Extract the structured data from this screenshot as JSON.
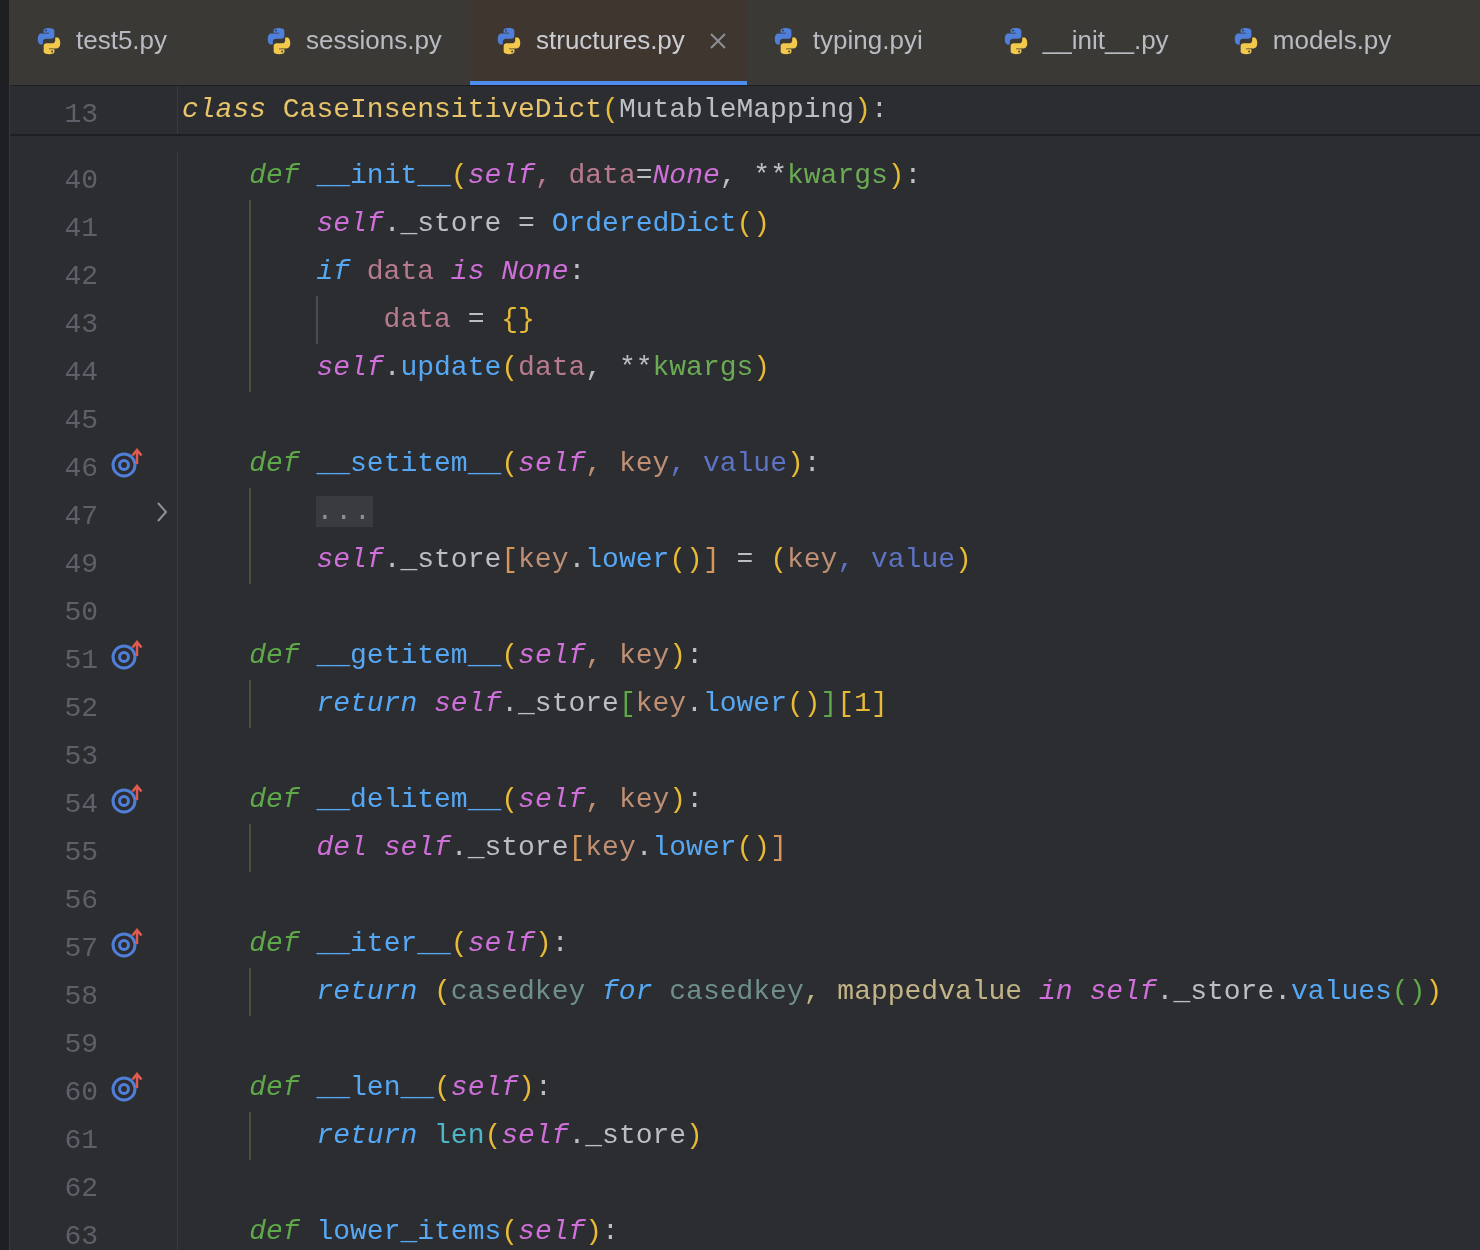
{
  "tabs": [
    {
      "label": "test5.py",
      "selected": false
    },
    {
      "label": "sessions.py",
      "selected": false
    },
    {
      "label": "structures.py",
      "selected": true
    },
    {
      "label": "typing.pyi",
      "selected": false
    },
    {
      "label": "__init__.py",
      "selected": false
    },
    {
      "label": "models.py",
      "selected": false
    }
  ],
  "sticky_line": {
    "number": "13",
    "tokens": [
      {
        "text": "class",
        "kind": "decl"
      },
      {
        "text": " CaseInsensitiveDict",
        "kind": "cls"
      },
      {
        "text": "(",
        "kind": "paren1"
      },
      {
        "text": "MutableMapping",
        "kind": "plain"
      },
      {
        "text": ")",
        "kind": "paren1"
      },
      {
        "text": ":",
        "kind": "plain"
      }
    ]
  },
  "lines": [
    {
      "number": "40",
      "tokens": [
        {
          "text": "def",
          "kind": "def"
        },
        {
          "text": " __init__",
          "kind": "fn"
        },
        {
          "text": "(",
          "kind": "paren1"
        },
        {
          "text": "self",
          "kind": "self"
        },
        {
          "text": ", data",
          "kind": "param"
        },
        {
          "text": "=",
          "kind": "plain"
        },
        {
          "text": "None",
          "kind": "const"
        },
        {
          "text": ", **",
          "kind": "plain"
        },
        {
          "text": "kwargs",
          "kind": "kwargs"
        },
        {
          "text": ")",
          "kind": "paren1"
        },
        {
          "text": ":",
          "kind": "plain"
        }
      ],
      "children": [
        {
          "number": "41",
          "tokens": [
            {
              "text": "self",
              "kind": "self"
            },
            {
              "text": "._store = ",
              "kind": "plain"
            },
            {
              "text": "OrderedDict",
              "kind": "fn"
            },
            {
              "text": "()",
              "kind": "paren1"
            }
          ]
        },
        {
          "number": "42",
          "tokens": [
            {
              "text": "if",
              "kind": "ctl"
            },
            {
              "text": " data",
              "kind": "param"
            },
            {
              "text": " is",
              "kind": "const"
            },
            {
              "text": " None",
              "kind": "const"
            },
            {
              "text": ":",
              "kind": "plain"
            }
          ],
          "children": [
            {
              "number": "43",
              "tokens": [
                {
                  "text": "data",
                  "kind": "param"
                },
                {
                  "text": " = ",
                  "kind": "plain"
                },
                {
                  "text": "{}",
                  "kind": "paren1"
                }
              ]
            }
          ]
        },
        {
          "number": "44",
          "tokens": [
            {
              "text": "self",
              "kind": "self"
            },
            {
              "text": ".",
              "kind": "plain"
            },
            {
              "text": "update",
              "kind": "fn"
            },
            {
              "text": "(",
              "kind": "paren1"
            },
            {
              "text": "data",
              "kind": "param"
            },
            {
              "text": ", **",
              "kind": "plain"
            },
            {
              "text": "kwargs",
              "kind": "kwargs"
            },
            {
              "text": ")",
              "kind": "paren1"
            }
          ]
        }
      ]
    },
    {
      "number": "45"
    },
    {
      "number": "46",
      "overridden": true,
      "tokens": [
        {
          "text": "def",
          "kind": "def"
        },
        {
          "text": " __setitem__",
          "kind": "fn"
        },
        {
          "text": "(",
          "kind": "paren1"
        },
        {
          "text": "self",
          "kind": "self"
        },
        {
          "text": ", key",
          "kind": "arg"
        },
        {
          "text": ", value",
          "kind": "arg2"
        },
        {
          "text": ")",
          "kind": "paren1"
        },
        {
          "text": ":",
          "kind": "plain"
        }
      ],
      "children": [
        {
          "number": "47",
          "folded": true,
          "tokens": [
            {
              "text": "...",
              "kind": "placeholder"
            }
          ]
        },
        {
          "number": "49",
          "tokens": [
            {
              "text": "self",
              "kind": "self"
            },
            {
              "text": "._store",
              "kind": "plain"
            },
            {
              "text": "[",
              "kind": "paren2"
            },
            {
              "text": "key",
              "kind": "arg"
            },
            {
              "text": ".",
              "kind": "plain"
            },
            {
              "text": "lower",
              "kind": "fn"
            },
            {
              "text": "()",
              "kind": "paren1"
            },
            {
              "text": "]",
              "kind": "paren2"
            },
            {
              "text": " = ",
              "kind": "plain"
            },
            {
              "text": "(",
              "kind": "paren1"
            },
            {
              "text": "key",
              "kind": "arg"
            },
            {
              "text": ", value",
              "kind": "arg2"
            },
            {
              "text": ")",
              "kind": "paren1"
            }
          ]
        }
      ]
    },
    {
      "number": "50"
    },
    {
      "number": "51",
      "overridden": true,
      "tokens": [
        {
          "text": "def",
          "kind": "def"
        },
        {
          "text": " __getitem__",
          "kind": "fn"
        },
        {
          "text": "(",
          "kind": "paren1"
        },
        {
          "text": "self",
          "kind": "self"
        },
        {
          "text": ", key",
          "kind": "arg"
        },
        {
          "text": ")",
          "kind": "paren1"
        },
        {
          "text": ":",
          "kind": "plain"
        }
      ],
      "children": [
        {
          "number": "52",
          "tokens": [
            {
              "text": "return",
              "kind": "ctl"
            },
            {
              "text": " self",
              "kind": "self"
            },
            {
              "text": "._store",
              "kind": "plain"
            },
            {
              "text": "[",
              "kind": "paren3"
            },
            {
              "text": "key",
              "kind": "arg"
            },
            {
              "text": ".",
              "kind": "plain"
            },
            {
              "text": "lower",
              "kind": "fn"
            },
            {
              "text": "()",
              "kind": "paren1"
            },
            {
              "text": "]",
              "kind": "paren3"
            },
            {
              "text": "[1]",
              "kind": "paren1"
            }
          ]
        }
      ]
    },
    {
      "number": "53"
    },
    {
      "number": "54",
      "overridden": true,
      "tokens": [
        {
          "text": "def",
          "kind": "def"
        },
        {
          "text": " __delitem__",
          "kind": "fn"
        },
        {
          "text": "(",
          "kind": "paren1"
        },
        {
          "text": "self",
          "kind": "self"
        },
        {
          "text": ", key",
          "kind": "arg"
        },
        {
          "text": ")",
          "kind": "paren1"
        },
        {
          "text": ":",
          "kind": "plain"
        }
      ],
      "children": [
        {
          "number": "55",
          "tokens": [
            {
              "text": "del",
              "kind": "const"
            },
            {
              "text": " self",
              "kind": "self"
            },
            {
              "text": "._store",
              "kind": "plain"
            },
            {
              "text": "[",
              "kind": "paren2"
            },
            {
              "text": "key",
              "kind": "arg"
            },
            {
              "text": ".",
              "kind": "plain"
            },
            {
              "text": "lower",
              "kind": "fn"
            },
            {
              "text": "()",
              "kind": "paren1"
            },
            {
              "text": "]",
              "kind": "paren2"
            }
          ]
        }
      ]
    },
    {
      "number": "56"
    },
    {
      "number": "57",
      "overridden": true,
      "tokens": [
        {
          "text": "def",
          "kind": "def"
        },
        {
          "text": " __iter__",
          "kind": "fn"
        },
        {
          "text": "(",
          "kind": "paren1"
        },
        {
          "text": "self",
          "kind": "self"
        },
        {
          "text": ")",
          "kind": "paren1"
        },
        {
          "text": ":",
          "kind": "plain"
        }
      ],
      "children": [
        {
          "number": "58",
          "tokens": [
            {
              "text": "return",
              "kind": "ctl"
            },
            {
              "text": " (",
              "kind": "paren1"
            },
            {
              "text": "casedkey",
              "kind": "local"
            },
            {
              "text": " for",
              "kind": "ctl"
            },
            {
              "text": " casedkey",
              "kind": "local"
            },
            {
              "text": ", mappedvalue",
              "kind": "local2"
            },
            {
              "text": " in",
              "kind": "const"
            },
            {
              "text": " self",
              "kind": "self"
            },
            {
              "text": "._store.",
              "kind": "plain"
            },
            {
              "text": "values",
              "kind": "fn"
            },
            {
              "text": "()",
              "kind": "paren3"
            },
            {
              "text": ")",
              "kind": "paren1"
            }
          ]
        }
      ]
    },
    {
      "number": "59"
    },
    {
      "number": "60",
      "overridden": true,
      "tokens": [
        {
          "text": "def",
          "kind": "def"
        },
        {
          "text": " __len__",
          "kind": "fn"
        },
        {
          "text": "(",
          "kind": "paren1"
        },
        {
          "text": "self",
          "kind": "self"
        },
        {
          "text": ")",
          "kind": "paren1"
        },
        {
          "text": ":",
          "kind": "plain"
        }
      ],
      "children": [
        {
          "number": "61",
          "tokens": [
            {
              "text": "return",
              "kind": "ctl"
            },
            {
              "text": " len",
              "kind": "builtin"
            },
            {
              "text": "(",
              "kind": "paren1"
            },
            {
              "text": "self",
              "kind": "self"
            },
            {
              "text": "._store",
              "kind": "plain"
            },
            {
              "text": ")",
              "kind": "paren1"
            }
          ]
        }
      ]
    },
    {
      "number": "62"
    },
    {
      "number": "63",
      "tokens": [
        {
          "text": "def",
          "kind": "def"
        },
        {
          "text": " lower_items",
          "kind": "fn"
        },
        {
          "text": "(",
          "kind": "paren1"
        },
        {
          "text": "self",
          "kind": "self"
        },
        {
          "text": ")",
          "kind": "paren1"
        },
        {
          "text": ":",
          "kind": "plain"
        }
      ]
    }
  ]
}
